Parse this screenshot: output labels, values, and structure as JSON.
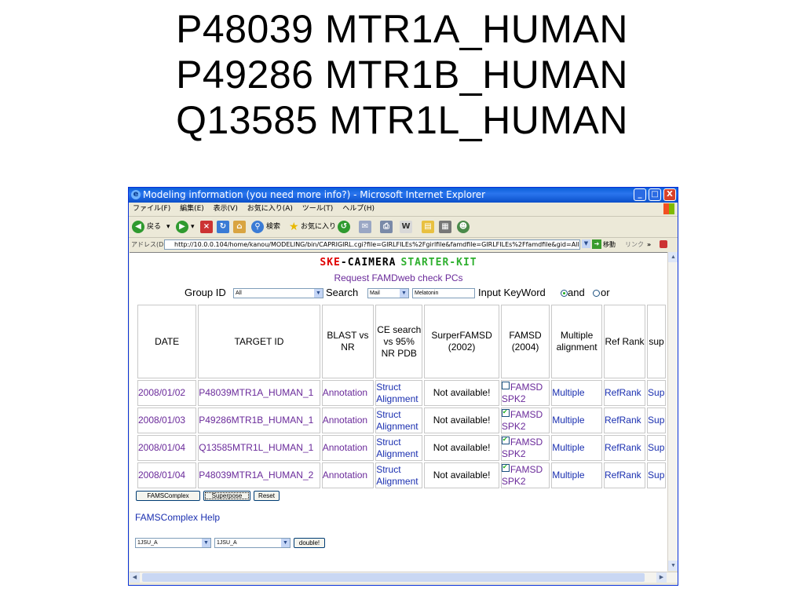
{
  "slide": {
    "title_lines": [
      "P48039 MTR1A_HUMAN",
      "P49286 MTR1B_HUMAN",
      "Q13585 MTR1L_HUMAN"
    ]
  },
  "window": {
    "title": "Modeling information (you need more info?) - Microsoft Internet Explorer",
    "title_icon": "e",
    "controls": {
      "minimize": "_",
      "maximize": "□",
      "close": "X"
    }
  },
  "menu": [
    "ファイル(F)",
    "編集(E)",
    "表示(V)",
    "お気に入り(A)",
    "ツール(T)",
    "ヘルプ(H)"
  ],
  "toolbar": {
    "back_label": "戻る",
    "search_label": "検索",
    "favorites_label": "お気に入り"
  },
  "address": {
    "label": "アドレス(D)",
    "url": "http://10.0.0.104/home/kanou/MODELING/bin/CAPRIGIRL.cgi?file=GIRLFILEs%2Fgirlfile&famdfile=GIRLFILEs%2Ffamdfile&gid=All&obj=",
    "go_label": "移動",
    "links_label": "リンク"
  },
  "page": {
    "logo": {
      "part1": "SKE",
      "dash": "-",
      "part2": "CAIMERA",
      "part3": "STARTER-KIT"
    },
    "request_link": "Request FAMDweb check PCs",
    "search": {
      "group_label": "Group ID",
      "group_value": "All",
      "search_label": "Search",
      "search_value": "Mail",
      "input_value": "Melatonin",
      "keyword_label": "Input KeyWord",
      "and_label": "and",
      "or_label": "or"
    },
    "table": {
      "headers": [
        "DATE",
        "TARGET ID",
        "BLAST vs NR",
        "CE search vs 95% NR PDB",
        "SurperFAMSD (2002)",
        "FAMSD (2004)",
        "Multiple alignment",
        "Ref Rank",
        "sup"
      ],
      "rows": [
        {
          "date": "2008/01/02",
          "target": "P48039MTR1A_HUMAN_1",
          "blast": "Annotation",
          "ce1": "Struct",
          "ce2": "Alignment",
          "surper": "Not available!",
          "famsd1": "FAMSD",
          "famsd2": "SPK2",
          "checked": "no",
          "multiple": "Multiple",
          "ref": "RefRank",
          "sup": "Sup"
        },
        {
          "date": "2008/01/03",
          "target": "P49286MTR1B_HUMAN_1",
          "blast": "Annotation",
          "ce1": "Struct",
          "ce2": "Alignment",
          "surper": "Not available!",
          "famsd1": "FAMSD",
          "famsd2": "SPK2",
          "checked": "yes",
          "multiple": "Multiple",
          "ref": "RefRank",
          "sup": "Sup"
        },
        {
          "date": "2008/01/04",
          "target": "Q13585MTR1L_HUMAN_1",
          "blast": "Annotation",
          "ce1": "Struct",
          "ce2": "Alignment",
          "surper": "Not available!",
          "famsd1": "FAMSD",
          "famsd2": "SPK2",
          "checked": "yes",
          "multiple": "Multiple",
          "ref": "RefRank",
          "sup": "Sup"
        },
        {
          "date": "2008/01/04",
          "target": "P48039MTR1A_HUMAN_2",
          "blast": "Annotation",
          "ce1": "Struct",
          "ce2": "Alignment",
          "surper": "Not available!",
          "famsd1": "FAMSD",
          "famsd2": "SPK2",
          "checked": "yes",
          "multiple": "Multiple",
          "ref": "RefRank",
          "sup": "Sup"
        }
      ]
    },
    "buttons": {
      "famscomplex": "FAMSComplex",
      "superpose": "Superpose",
      "reset": "Reset"
    },
    "help_link": "FAMSComplex Help",
    "selects": {
      "first": "1JSU_A",
      "second": "1JSU_A",
      "double_button": "double!"
    }
  },
  "colors": {
    "visited_link": "#6a2a9a",
    "link": "#1a2fb0",
    "titlebar": "#0a5fd8",
    "logo_red": "#e00000",
    "logo_green": "#2fb02f"
  }
}
